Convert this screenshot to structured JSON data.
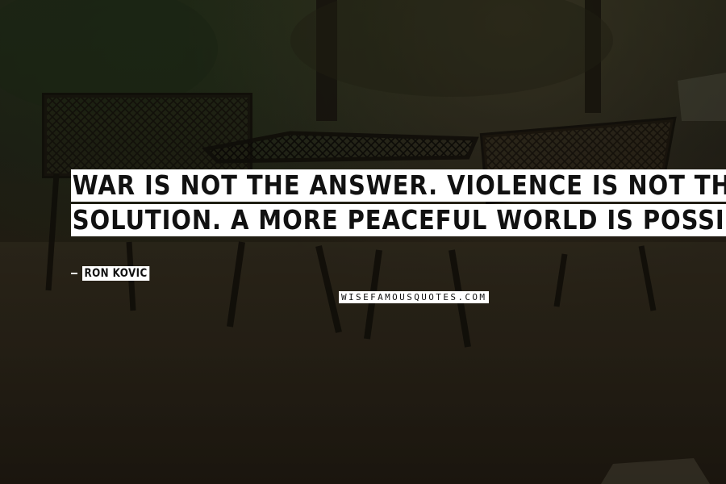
{
  "quote": {
    "lines": [
      "WAR IS NOT THE ANSWER. VIOLENCE IS NOT THE",
      "SOLUTION. A MORE PEACEFUL WORLD IS POSSIBLE."
    ]
  },
  "author": {
    "name": "RON KOVIC"
  },
  "watermark": {
    "text": "WISEFAMOUSQUOTES.COM"
  },
  "colors": {
    "label_background": "#ffffff",
    "text": "#111111",
    "scene_dark": "#231d14"
  }
}
